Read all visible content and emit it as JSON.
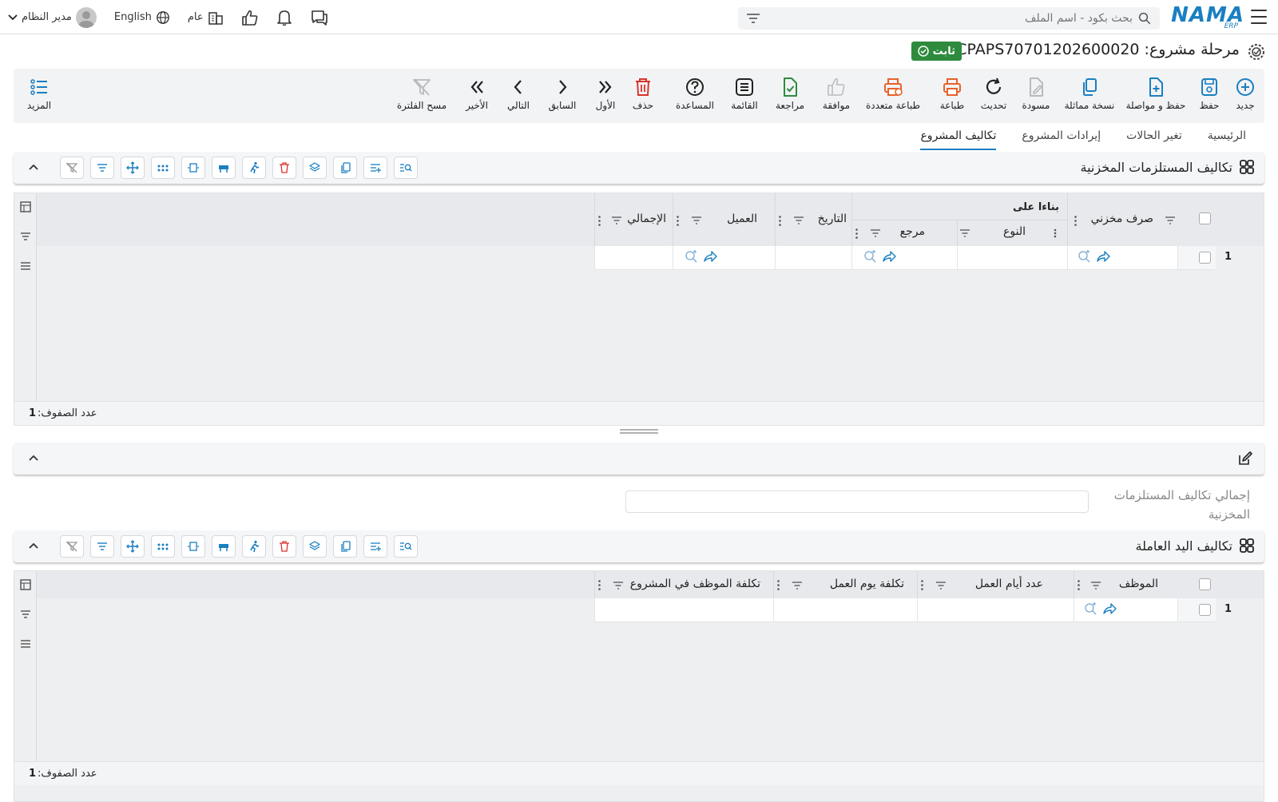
{
  "topbar": {
    "logo_text": "NAMA",
    "logo_sub": "ERP",
    "search_placeholder": "بحث بكود - اسم الملف",
    "user_name": "مدير النظام",
    "language": "English",
    "branch": "عام"
  },
  "page": {
    "title": "مرحلة مشروع: CPAPS70701202600020",
    "status_badge": "ثابت"
  },
  "toolbar": {
    "new": "جديد",
    "save": "حفظ",
    "save_continue": "حفظ و مواصلة",
    "duplicate": "نسخة مماثلة",
    "draft": "مسودة",
    "refresh": "تحديث",
    "print": "طباعة",
    "multi_print": "طباعة متعددة",
    "approve": "موافقة",
    "review": "مراجعة",
    "list": "القائمة",
    "help": "المساعدة",
    "delete": "حذف",
    "first": "الأول",
    "previous": "السابق",
    "next": "التالي",
    "last": "الأخير",
    "clear_filter": "مسح الفلترة",
    "more": "المزيد"
  },
  "tabs": [
    {
      "label": "الرئيسية",
      "active": false
    },
    {
      "label": "تغير الحالات",
      "active": false
    },
    {
      "label": "إيرادات المشروع",
      "active": false
    },
    {
      "label": "تكاليف المشروع",
      "active": true
    }
  ],
  "inventory_panel": {
    "title": "تكاليف المستلزمات المخزنية",
    "columns": {
      "issue": "صرف مخزني",
      "based_on": "بناءا على",
      "type": "النوع",
      "ref": "مرجع",
      "date": "التاريخ",
      "customer": "العميل",
      "total": "الإجمالي"
    },
    "rows": [
      {
        "num": "1"
      }
    ],
    "row_count_label": "عدد الصفوف:",
    "row_count": "1"
  },
  "edit_panel": {
    "field_label_line1": "إجمالي تكاليف المستلزمات",
    "field_label_line2": "المخزنية",
    "field_value": ""
  },
  "labor_panel": {
    "title": "تكاليف اليد العاملة",
    "columns": {
      "employee": "الموظف",
      "work_days": "عدد أيام العمل",
      "day_cost": "تكلفة يوم العمل",
      "employee_cost": "تكلفة الموظف في المشروع"
    },
    "rows": [
      {
        "num": "1"
      }
    ],
    "row_count_label": "عدد الصفوف:",
    "row_count": "1"
  }
}
